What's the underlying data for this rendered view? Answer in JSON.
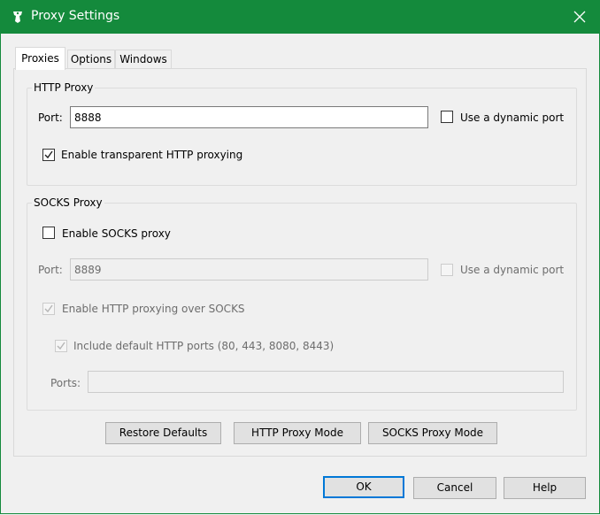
{
  "window": {
    "title": "Proxy Settings"
  },
  "tabs": [
    {
      "label": "Proxies",
      "active": true
    },
    {
      "label": "Options",
      "active": false
    },
    {
      "label": "Windows",
      "active": false
    }
  ],
  "http_proxy": {
    "group_title": "HTTP Proxy",
    "port_label": "Port:",
    "port_value": "8888",
    "dynamic_port_label": "Use a dynamic port",
    "dynamic_port_checked": false,
    "transparent_label": "Enable transparent HTTP proxying",
    "transparent_checked": true
  },
  "socks_proxy": {
    "group_title": "SOCKS Proxy",
    "enable_label": "Enable SOCKS proxy",
    "enable_checked": false,
    "port_label": "Port:",
    "port_value": "8889",
    "dynamic_port_label": "Use a dynamic port",
    "http_over_socks_label": "Enable HTTP proxying over SOCKS",
    "include_ports_label": "Include default HTTP ports (80, 443, 8080, 8443)",
    "ports_label": "Ports:",
    "ports_value": ""
  },
  "mode_buttons": {
    "restore_defaults": "Restore Defaults",
    "http_mode": "HTTP Proxy Mode",
    "socks_mode": "SOCKS Proxy Mode"
  },
  "dialog_buttons": {
    "ok": "OK",
    "cancel": "Cancel",
    "help": "Help"
  },
  "icons": {
    "app": "fiddler-icon",
    "close": "close-icon",
    "check": "check-icon"
  },
  "colors": {
    "titlebar": "#148a3c",
    "default_button_border": "#0078d7"
  }
}
